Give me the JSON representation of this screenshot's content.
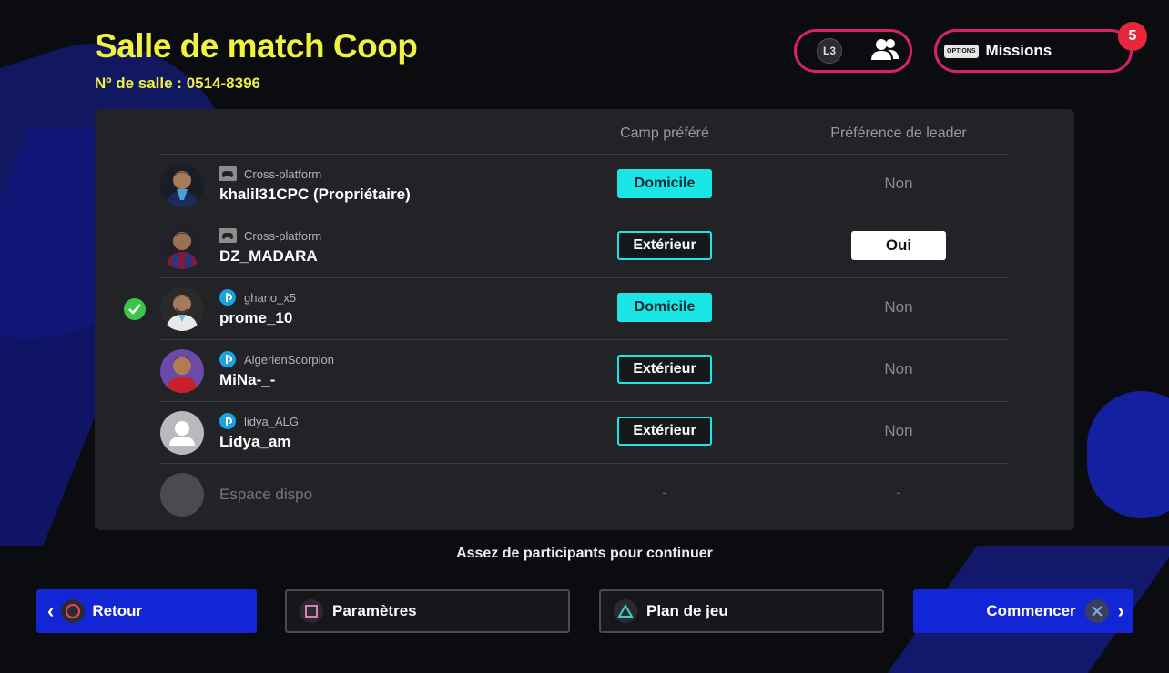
{
  "header": {
    "title": "Salle de match Coop",
    "room_id": "Nº de salle : 0514-8396",
    "friends_key": "L3",
    "missions_key": "OPTIONS",
    "missions_label": "Missions",
    "missions_count": "5"
  },
  "table": {
    "columns": {
      "camp": "Camp préféré",
      "leader": "Préférence de leader"
    },
    "players": [
      {
        "platform": "Cross-platform",
        "platform_icon": "gamepad-icon",
        "name": "khalil31CPC (Propriétaire)",
        "camp": "Domicile",
        "camp_style": "filled",
        "leader": "Non",
        "ready": false
      },
      {
        "platform": "Cross-platform",
        "platform_icon": "gamepad-icon",
        "name": "DZ_MADARA",
        "camp": "Extérieur",
        "camp_style": "outline",
        "leader": "Oui",
        "ready": false
      },
      {
        "platform": "ghano_x5",
        "platform_icon": "playstation-icon",
        "name": "prome_10",
        "camp": "Domicile",
        "camp_style": "filled",
        "leader": "Non",
        "ready": true
      },
      {
        "platform": "AlgerienScorpion",
        "platform_icon": "playstation-icon",
        "name": "MiNa-_-",
        "camp": "Extérieur",
        "camp_style": "outline",
        "leader": "Non",
        "ready": false
      },
      {
        "platform": "lidya_ALG",
        "platform_icon": "playstation-icon",
        "name": "Lidya_am",
        "camp": "Extérieur",
        "camp_style": "outline",
        "leader": "Non",
        "ready": false
      }
    ],
    "empty_slot": {
      "label": "Espace dispo",
      "camp": "-",
      "leader": "-"
    }
  },
  "status": "Assez de participants pour continuer",
  "footer": {
    "back": "Retour",
    "params": "Paramètres",
    "plan": "Plan de jeu",
    "start": "Commencer"
  },
  "colors": {
    "title": "#f0f240",
    "accent_cyan": "#1ae6e6",
    "pill_border": "#d8206e",
    "button_blue": "#1326d6",
    "badge_red": "#e8283a",
    "ready_green": "#3ec44b"
  }
}
